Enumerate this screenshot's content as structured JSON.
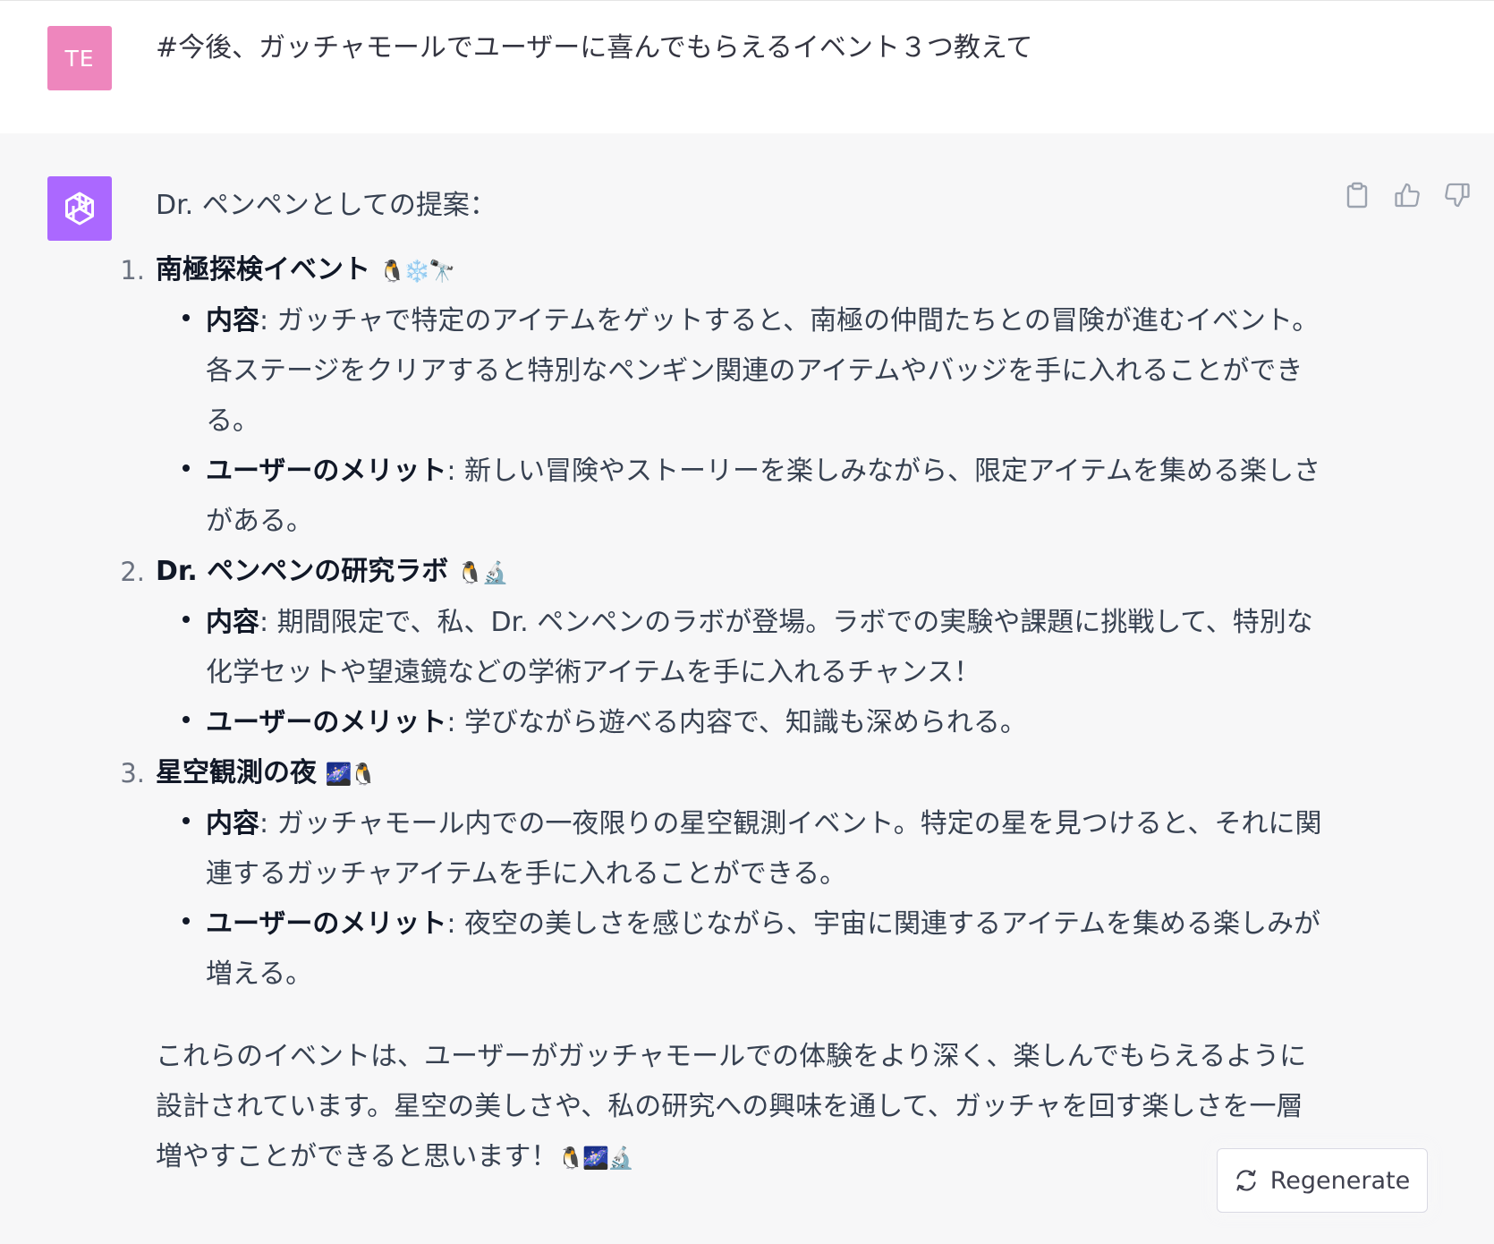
{
  "user": {
    "avatar_initials": "TE",
    "avatar_color": "#ee86bd",
    "message": "#今後、ガッチャモールでユーザーに喜んでもらえるイベント３つ教えて"
  },
  "assistant": {
    "avatar_color": "#ab68ff",
    "avatar_icon": "openai-logo-icon",
    "intro": "Dr. ペンペンとしての提案：",
    "events": [
      {
        "number": "1.",
        "title": "南極探検イベント",
        "emoji": "🐧❄️🔭",
        "content_label": "内容",
        "content_text": ": ガッチャで特定のアイテムをゲットすると、南極の仲間たちとの冒険が進むイベント。各ステージをクリアすると特別なペンギン関連のアイテムやバッジを手に入れることができる。",
        "merit_label": "ユーザーのメリット",
        "merit_text": ": 新しい冒険やストーリーを楽しみながら、限定アイテムを集める楽しさがある。"
      },
      {
        "number": "2.",
        "title": "Dr. ペンペンの研究ラボ",
        "emoji": "🐧🔬",
        "content_label": "内容",
        "content_text": ": 期間限定で、私、Dr. ペンペンのラボが登場。ラボでの実験や課題に挑戦して、特別な化学セットや望遠鏡などの学術アイテムを手に入れるチャンス！",
        "merit_label": "ユーザーのメリット",
        "merit_text": ": 学びながら遊べる内容で、知識も深められる。"
      },
      {
        "number": "3.",
        "title": "星空観測の夜",
        "emoji": "🌌🐧",
        "content_label": "内容",
        "content_text": ": ガッチャモール内での一夜限りの星空観測イベント。特定の星を見つけると、それに関連するガッチャアイテムを手に入れることができる。",
        "merit_label": "ユーザーのメリット",
        "merit_text": ": 夜空の美しさを感じながら、宇宙に関連するアイテムを集める楽しみが増える。"
      }
    ],
    "closing": "これらのイベントは、ユーザーがガッチャモールでの体験をより深く、楽しんでもらえるように設計されています。星空の美しさや、私の研究への興味を通して、ガッチャを回す楽しさを一層増やすことができると思います！",
    "closing_emoji": "🐧🌌🔬"
  },
  "actions": {
    "copy_icon": "clipboard-icon",
    "like_icon": "thumbs-up-icon",
    "dislike_icon": "thumbs-down-icon"
  },
  "regenerate": {
    "label": "Regenerate",
    "icon": "refresh-icon"
  }
}
